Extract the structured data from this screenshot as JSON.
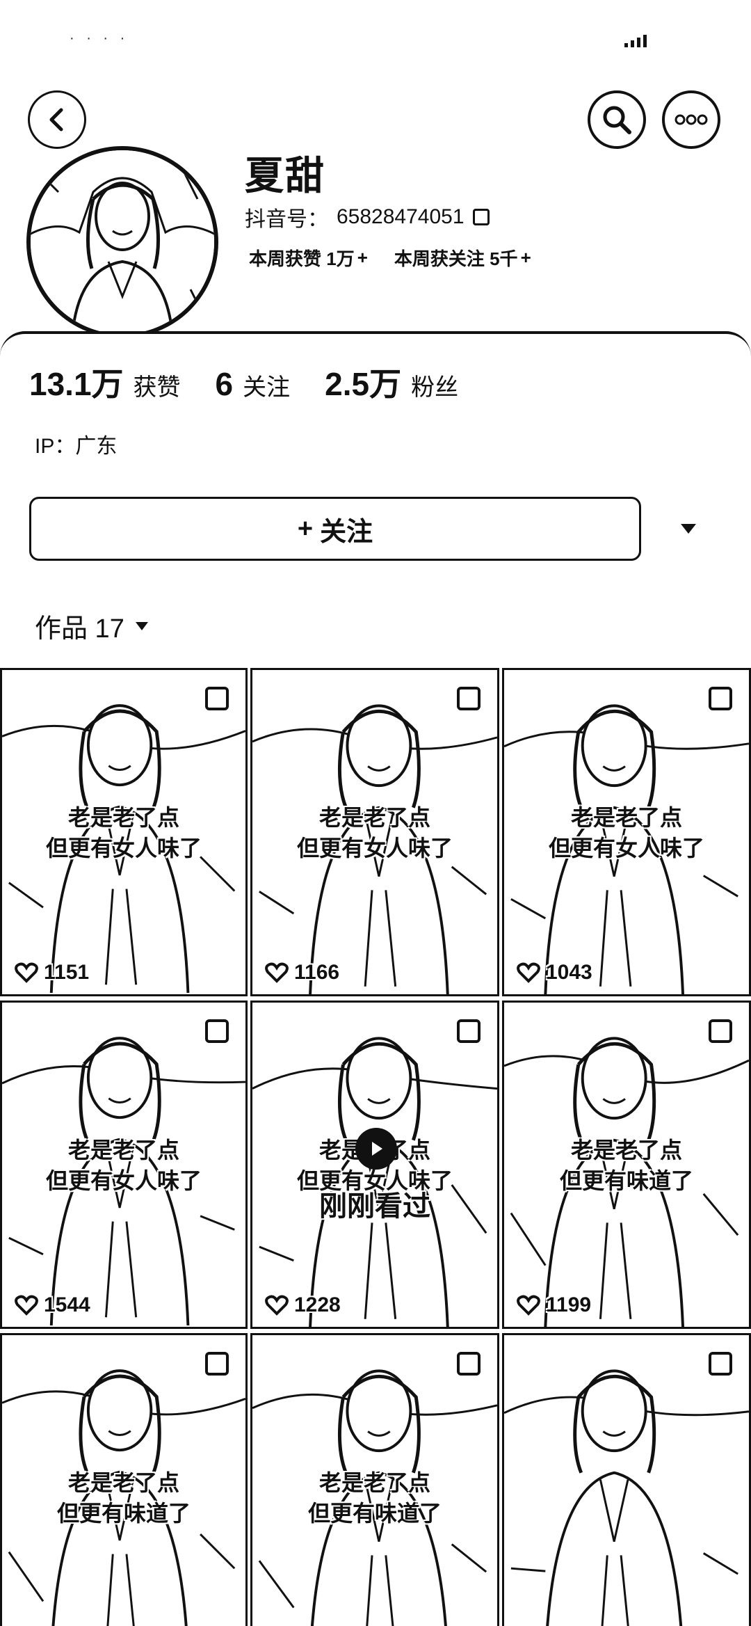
{
  "status_bar": {
    "left_text": "· · · ·"
  },
  "profile": {
    "nickname": "夏甜",
    "id_label": "抖音号：",
    "id_value": "65828474051",
    "weekly": [
      {
        "label": "本周获赞 1万",
        "suffix": "+"
      },
      {
        "label": "本周获关注 5千",
        "suffix": "+"
      }
    ]
  },
  "stats": [
    {
      "value": "13.1万",
      "label": "获赞"
    },
    {
      "value": "6",
      "label": "关注"
    },
    {
      "value": "2.5万",
      "label": "粉丝"
    }
  ],
  "ip": "IP：广东",
  "follow_button": {
    "icon": "+",
    "label": "关注"
  },
  "works_tab": {
    "label": "作品 17"
  },
  "videos": [
    {
      "caption_line1": "老是老了点",
      "caption_line2": "但更有女人味了",
      "likes": "1151",
      "recent": ""
    },
    {
      "caption_line1": "老是老了点",
      "caption_line2": "但更有女人味了",
      "likes": "1166",
      "recent": ""
    },
    {
      "caption_line1": "老是老了点",
      "caption_line2": "但更有女人味了",
      "likes": "1043",
      "recent": ""
    },
    {
      "caption_line1": "老是老了点",
      "caption_line2": "但更有女人味了",
      "likes": "1544",
      "recent": ""
    },
    {
      "caption_line1": "老是老了点",
      "caption_line2": "但更有女人味了",
      "likes": "1228",
      "recent": "刚刚看过"
    },
    {
      "caption_line1": "老是老了点",
      "caption_line2": "但更有味道了",
      "likes": "1199",
      "recent": ""
    },
    {
      "caption_line1": "老是老了点",
      "caption_line2": "但更有味道了",
      "likes": "",
      "recent": ""
    },
    {
      "caption_line1": "老是老了点",
      "caption_line2": "但更有味道了",
      "likes": "",
      "recent": ""
    },
    {
      "caption_line1": "",
      "caption_line2": "",
      "likes": "",
      "recent": ""
    }
  ],
  "icons": {
    "back": "chevron-left-icon",
    "search": "search-icon",
    "more": "more-horizontal-icon",
    "copy": "copy-icon",
    "dropdown": "triangle-down-icon",
    "like": "heart-icon",
    "select": "checkbox-icon",
    "play": "play-icon"
  }
}
